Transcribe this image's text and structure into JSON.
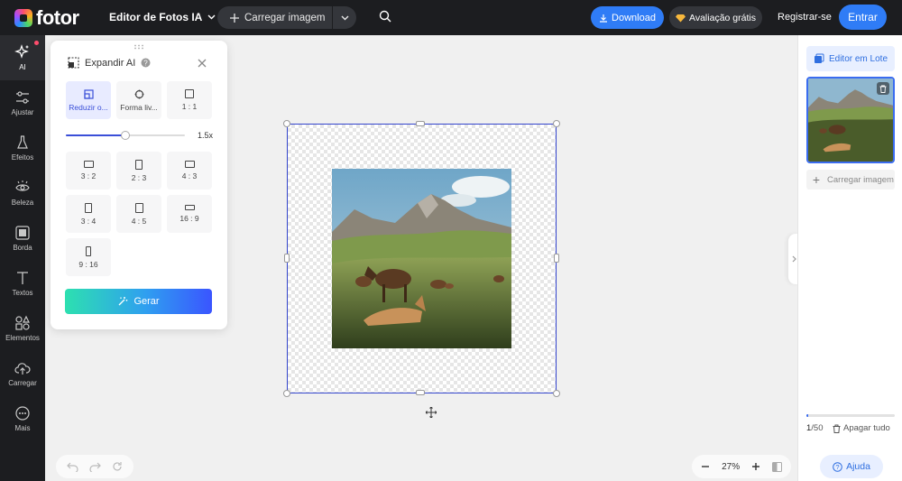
{
  "header": {
    "logo_text": "fotor",
    "editor_title": "Editor de Fotos IA",
    "upload_label": "Carregar imagem",
    "download_label": "Download",
    "trial_label": "Avaliação grátis",
    "register_label": "Registrar-se",
    "login_label": "Entrar"
  },
  "sidebar": {
    "items": [
      {
        "label": "AI",
        "icon": "sparkles-icon"
      },
      {
        "label": "Ajustar",
        "icon": "sliders-icon"
      },
      {
        "label": "Efeitos",
        "icon": "flask-icon"
      },
      {
        "label": "Beleza",
        "icon": "eye-icon"
      },
      {
        "label": "Borda",
        "icon": "border-icon"
      },
      {
        "label": "Textos",
        "icon": "text-icon"
      },
      {
        "label": "Elementos",
        "icon": "shapes-icon"
      },
      {
        "label": "Carregar",
        "icon": "cloud-upload-icon"
      },
      {
        "label": "Mais",
        "icon": "more-icon"
      }
    ]
  },
  "expand_panel": {
    "title": "Expandir AI",
    "modes": [
      {
        "label": "Reduzir o...",
        "selected": true
      },
      {
        "label": "Forma liv...",
        "selected": false
      },
      {
        "label": "1 : 1",
        "selected": false
      }
    ],
    "scale": {
      "value": 1.5,
      "label": "1.5x",
      "min": 1,
      "max": 2
    },
    "ratios": [
      "3 : 2",
      "2 : 3",
      "4 : 3",
      "3 : 4",
      "4 : 5",
      "16 : 9",
      "9 : 16"
    ],
    "generate_label": "Gerar"
  },
  "canvas": {
    "zoom_label": "27%"
  },
  "right_panel": {
    "batch_label": "Editor em Lote",
    "upload_label": "Carregar imagem",
    "quota_used": "1",
    "quota_total": "/50",
    "quota_fraction": 0.02,
    "clear_label": "Apagar tudo",
    "help_label": "Ajuda"
  },
  "colors": {
    "accent": "#2f7cf6",
    "selection": "#3344cc",
    "topbar": "#1c1d20"
  }
}
